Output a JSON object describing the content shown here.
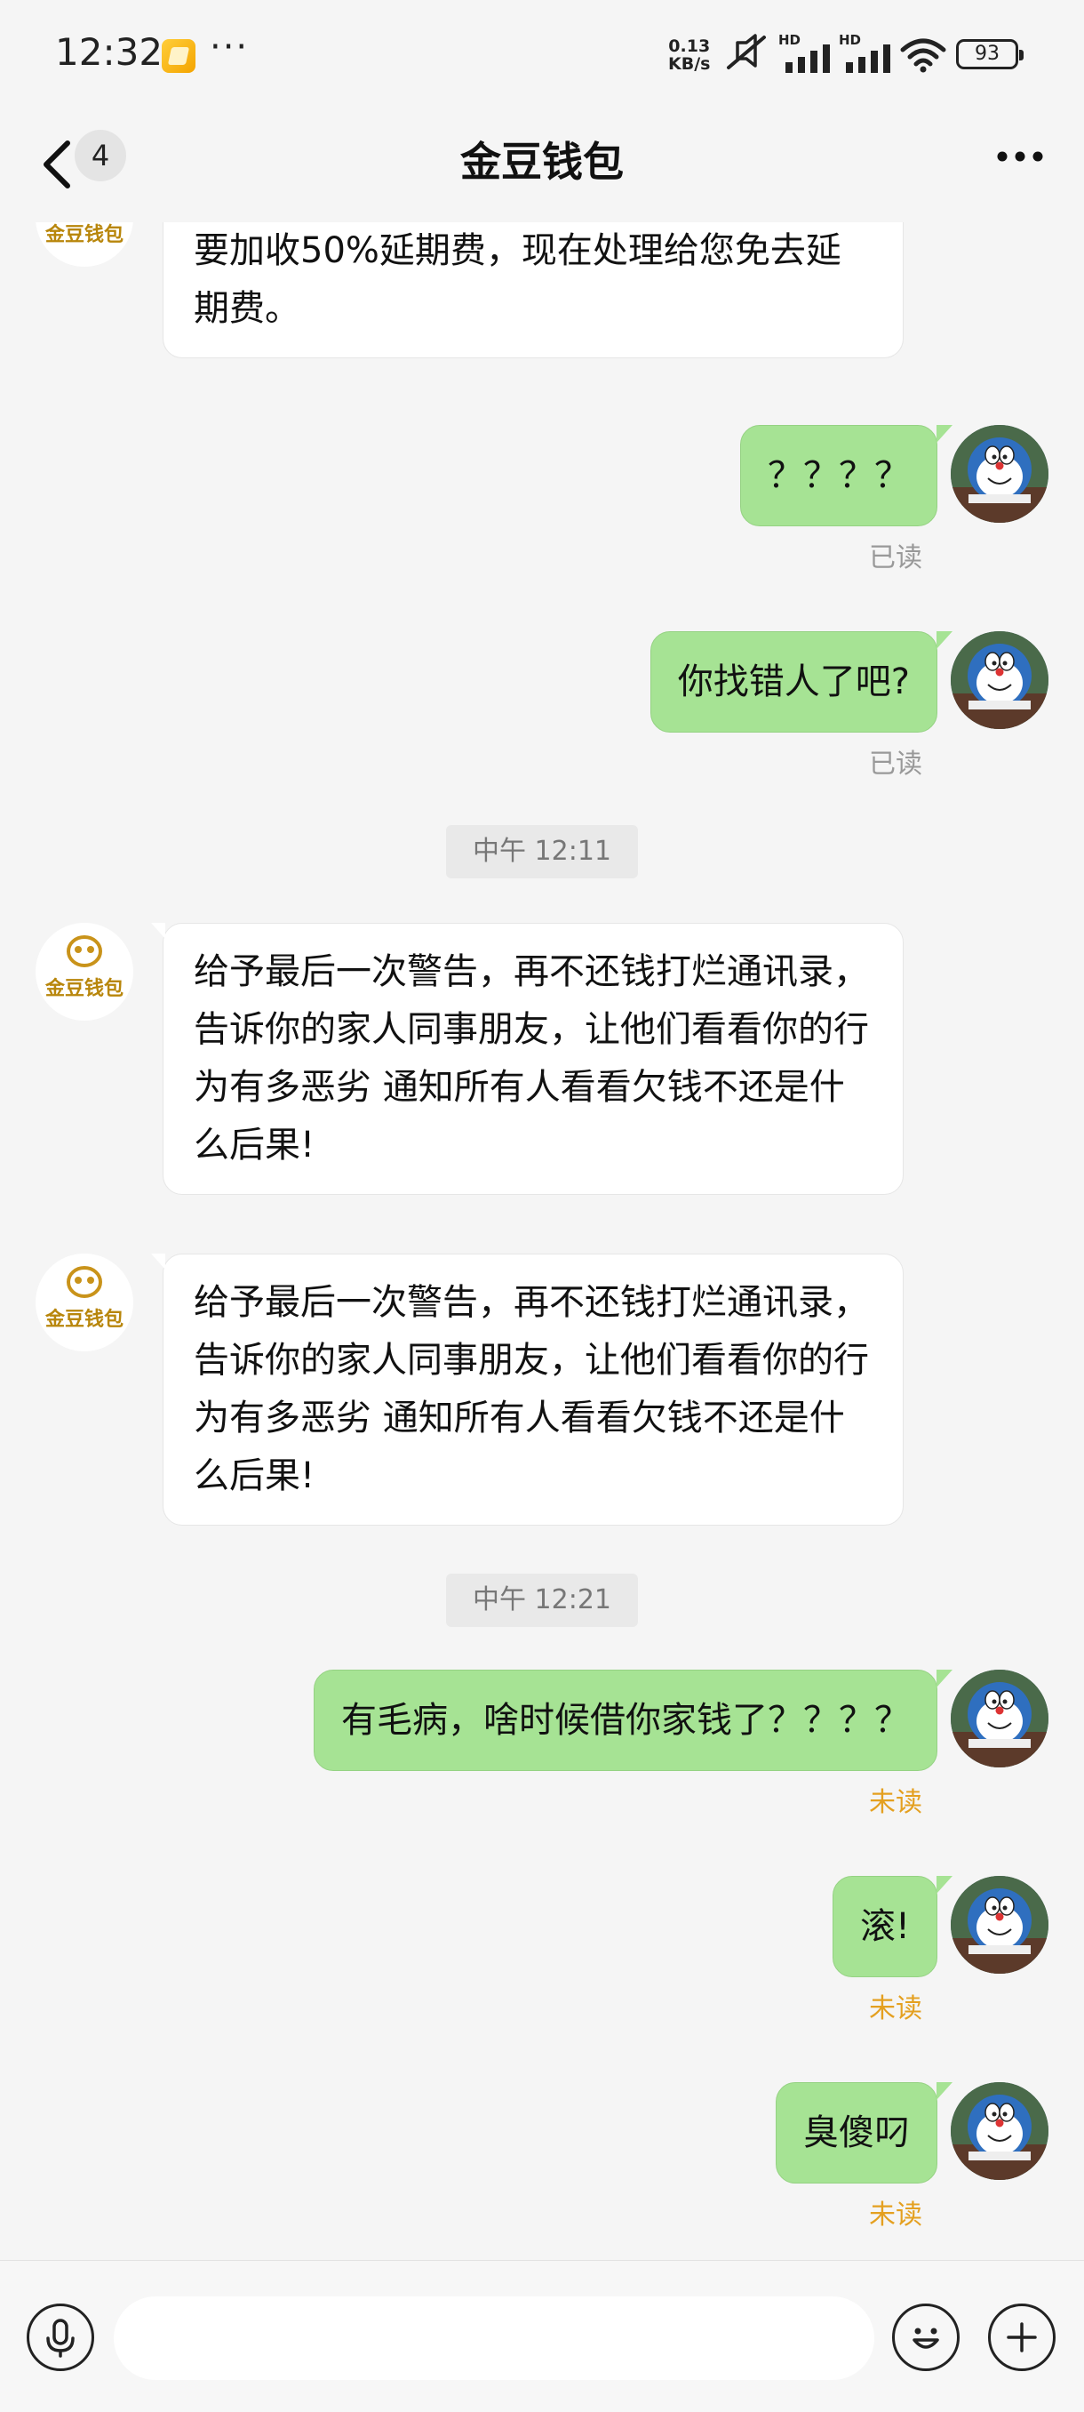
{
  "status_bar": {
    "time": "12:32",
    "dots": "···",
    "net_speed_value": "0.13",
    "net_speed_unit": "KB/s",
    "signal_1_label": "HD",
    "signal_2_label": "HD",
    "battery": "93"
  },
  "header": {
    "unread_count": "4",
    "title": "金豆钱包"
  },
  "messages": [
    {
      "side": "in",
      "text": "要加收50%延期费，现在处理给您免去延期费。"
    },
    {
      "side": "out",
      "text": "？？？？",
      "status": "已读"
    },
    {
      "side": "out",
      "text": "你找错人了吧?",
      "status": "已读"
    },
    {
      "type": "time",
      "text": "中午 12:11"
    },
    {
      "side": "in",
      "sender_logo": "金豆钱包",
      "text": "给予最后一次警告，再不还钱打烂通讯录，告诉你的家人同事朋友，让他们看看你的行为有多恶劣 通知所有人看看欠钱不还是什么后果!"
    },
    {
      "side": "in",
      "sender_logo": "金豆钱包",
      "text": "给予最后一次警告，再不还钱打烂通讯录，告诉你的家人同事朋友，让他们看看你的行为有多恶劣 通知所有人看看欠钱不还是什么后果!"
    },
    {
      "type": "time",
      "text": "中午 12:21"
    },
    {
      "side": "out",
      "text": "有毛病，啥时候借你家钱了？？？？",
      "status": "未读"
    },
    {
      "side": "out",
      "text": "滚!",
      "status": "未读"
    },
    {
      "side": "out",
      "text": "臭傻叼",
      "status": "未读"
    }
  ],
  "input_bar": {
    "placeholder": "",
    "icons": [
      "microphone-icon",
      "emoji-icon",
      "plus-icon"
    ]
  },
  "colors": {
    "outgoing_bubble": "#a6e394",
    "incoming_bubble": "#ffffff",
    "unread_status": "#e4a020",
    "read_status": "#999999",
    "logo_gold": "#b8860b"
  }
}
